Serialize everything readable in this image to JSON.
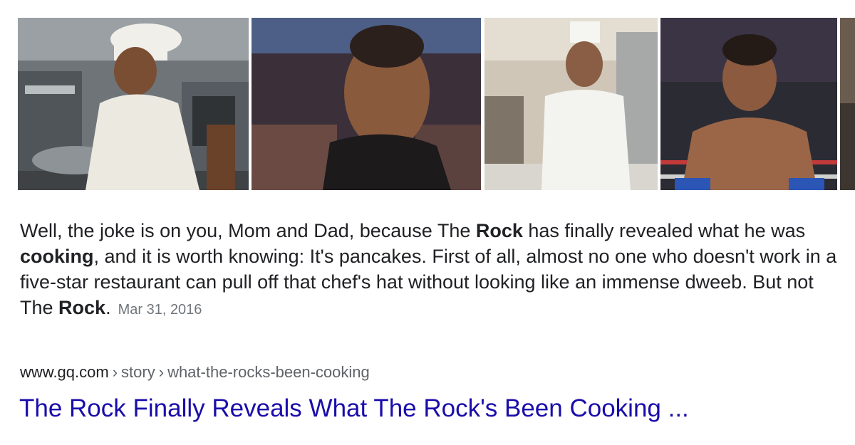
{
  "images": [
    {
      "name": "image-chef-kitchen",
      "alt": "The Rock in chef hat cooking in kitchen"
    },
    {
      "name": "image-arena-closeup",
      "alt": "The Rock raising eyebrow in arena"
    },
    {
      "name": "image-chef-smiling",
      "alt": "Smiling chef in white coat"
    },
    {
      "name": "image-wrestler-ring",
      "alt": "The Rock in wrestling ring"
    },
    {
      "name": "image-partial",
      "alt": "Partially visible thumbnail"
    }
  ],
  "snippet": {
    "t1": "Well, the joke is on you, Mom and Dad, because The ",
    "b1": "Rock",
    "t2": " has finally revealed what he was ",
    "b2": "cooking",
    "t3": ", and it is worth knowing: It's pancakes. First of all, almost no one who doesn't work in a five-star restaurant can pull off that chef's hat without looking like an immense dweeb. But not The ",
    "b3": "Rock",
    "t4": ".",
    "date": "Mar 31, 2016"
  },
  "result": {
    "domain": "www.gq.com",
    "separator": "›",
    "path": [
      "story",
      "what-the-rocks-been-cooking"
    ],
    "title": "The Rock Finally Reveals What The Rock's Been Cooking ..."
  },
  "colors": {
    "link": "#1a0dab",
    "text": "#202124",
    "muted": "#70757a"
  }
}
